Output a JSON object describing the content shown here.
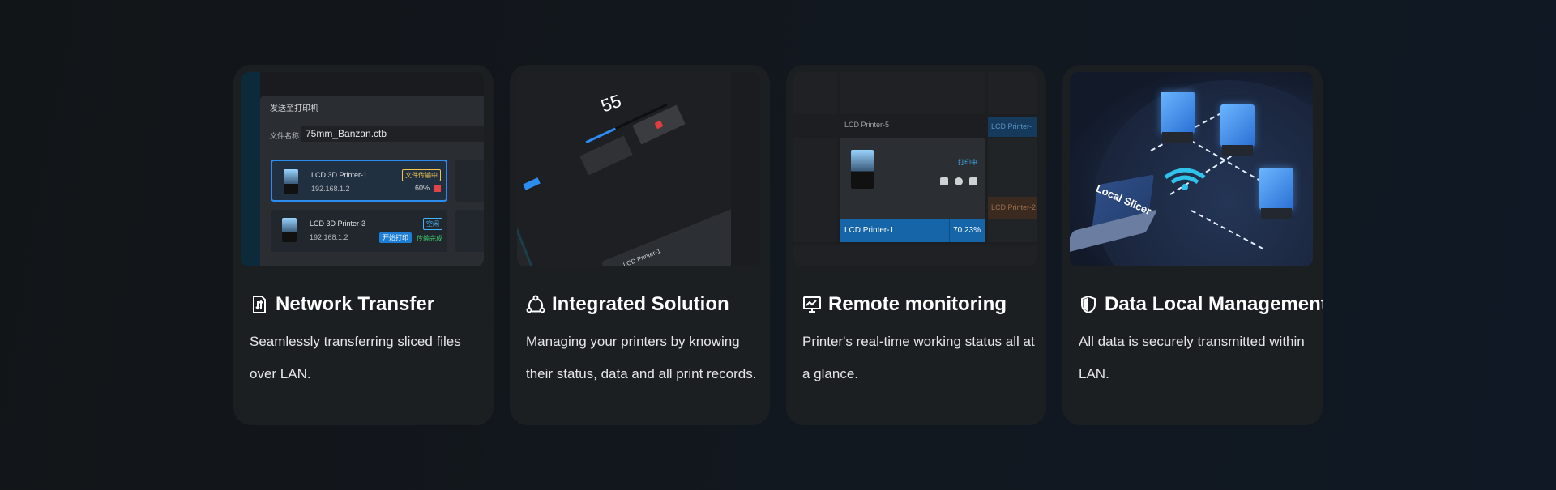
{
  "cards": [
    {
      "title": "Network Transfer",
      "icon": "file-transfer-icon",
      "description": "Seamlessly transferring sliced files over LAN.",
      "preview": {
        "dialog_title": "发送至打印机",
        "file_label": "文件名称",
        "file_name": "75mm_Banzan.ctb",
        "printers": [
          {
            "name": "LCD 3D Printer-1",
            "ip": "192.168.1.2",
            "tag": "文件传输中",
            "progress": "60%"
          },
          {
            "name": "LCD 3D Printer-3",
            "ip": "192.168.1.2",
            "tag": "空闲",
            "button": "开始打印",
            "status": "传输完成"
          }
        ]
      }
    },
    {
      "title": "Integrated Solution",
      "icon": "connected-nodes-icon",
      "description": "Managing your printers by knowing their status, data and all print records.",
      "preview": {
        "progress_value": "55",
        "printer_name": "LCD Printer-1"
      }
    },
    {
      "title": "Remote monitoring",
      "icon": "monitor-chart-icon",
      "description": "Printer's real-time working status all at a glance.",
      "preview": {
        "top_label": "LCD Printer-5",
        "status": "打印中",
        "selected_name": "LCD Printer-1",
        "selected_progress": "70.23%",
        "right_top": "LCD Printer-",
        "right_bottom": "LCD Printer-2"
      }
    },
    {
      "title": "Data Local Management",
      "icon": "shield-icon",
      "description": "All data is securely transmitted within LAN.",
      "preview": {
        "laptop_label": "Local Slicer"
      }
    }
  ],
  "colors": {
    "background": "#121518",
    "card": "#1c1f22",
    "accent": "#2d8cf0"
  }
}
